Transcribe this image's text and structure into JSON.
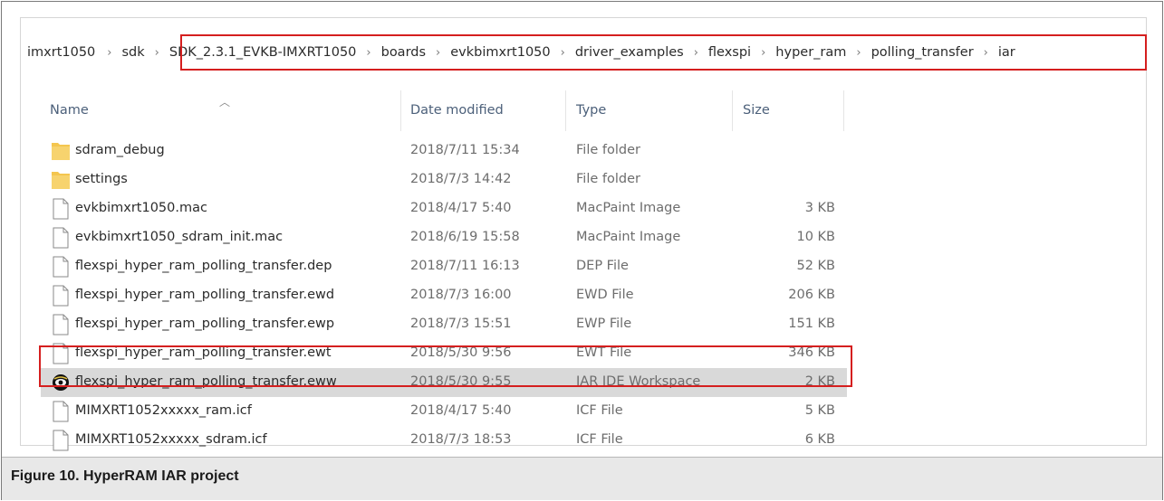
{
  "breadcrumb": [
    "imxrt1050",
    "sdk",
    "SDK_2.3.1_EVKB-IMXRT1050",
    "boards",
    "evkbimxrt1050",
    "driver_examples",
    "flexspi",
    "hyper_ram",
    "polling_transfer",
    "iar"
  ],
  "separator": "›",
  "columns": {
    "name": "Name",
    "date": "Date modified",
    "type": "Type",
    "size": "Size"
  },
  "files": [
    {
      "name": "sdram_debug",
      "date": "2018/7/11 15:34",
      "type": "File folder",
      "size": "",
      "icon": "folder-icon"
    },
    {
      "name": "settings",
      "date": "2018/7/3 14:42",
      "type": "File folder",
      "size": "",
      "icon": "folder-icon"
    },
    {
      "name": "evkbimxrt1050.mac",
      "date": "2018/4/17 5:40",
      "type": "MacPaint Image",
      "size": "3 KB",
      "icon": "file-icon"
    },
    {
      "name": "evkbimxrt1050_sdram_init.mac",
      "date": "2018/6/19 15:58",
      "type": "MacPaint Image",
      "size": "10 KB",
      "icon": "file-icon"
    },
    {
      "name": "flexspi_hyper_ram_polling_transfer.dep",
      "date": "2018/7/11 16:13",
      "type": "DEP File",
      "size": "52 KB",
      "icon": "file-icon"
    },
    {
      "name": "flexspi_hyper_ram_polling_transfer.ewd",
      "date": "2018/7/3 16:00",
      "type": "EWD File",
      "size": "206 KB",
      "icon": "file-icon"
    },
    {
      "name": "flexspi_hyper_ram_polling_transfer.ewp",
      "date": "2018/7/3 15:51",
      "type": "EWP File",
      "size": "151 KB",
      "icon": "file-icon"
    },
    {
      "name": "flexspi_hyper_ram_polling_transfer.ewt",
      "date": "2018/5/30 9:56",
      "type": "EWT File",
      "size": "346 KB",
      "icon": "file-icon"
    },
    {
      "name": "flexspi_hyper_ram_polling_transfer.eww",
      "date": "2018/5/30 9:55",
      "type": "IAR IDE Workspace",
      "size": "2 KB",
      "icon": "iar-workspace-icon"
    },
    {
      "name": "MIMXRT1052xxxxx_ram.icf",
      "date": "2018/4/17 5:40",
      "type": "ICF File",
      "size": "5 KB",
      "icon": "file-icon"
    },
    {
      "name": "MIMXRT1052xxxxx_sdram.icf",
      "date": "2018/7/3 18:53",
      "type": "ICF File",
      "size": "6 KB",
      "icon": "file-icon"
    }
  ],
  "figure_caption": "Figure 10. HyperRAM IAR project",
  "colors": {
    "highlight_border": "#d51f1f",
    "selected_row": "#d9d9d9",
    "folder_yellow": "#f4c64f"
  }
}
